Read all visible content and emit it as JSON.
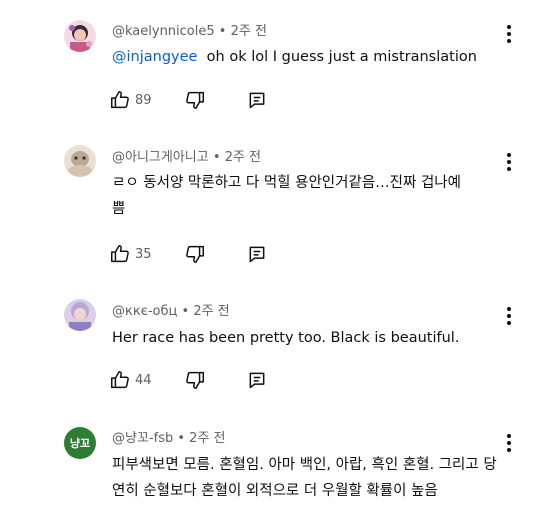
{
  "comments": [
    {
      "handle": "@kaelynnicole5",
      "sep": "•",
      "time": "2주 전",
      "mention": "@injangyee",
      "text": "oh ok lol I guess just a mistranslation",
      "likes": "89"
    },
    {
      "handle": "@아니그게아니고",
      "sep": "•",
      "time": "2주 전",
      "text": "ㄹㅇ 동서양 막론하고 다 먹힐 용안인거같음…진짜 겁나예쁨",
      "likes": "35"
    },
    {
      "handle": "@ккє-обц",
      "sep": "•",
      "time": "2주 전",
      "text": "Her race has been pretty too. Black is beautiful.",
      "likes": "44"
    },
    {
      "handle": "@냥꼬-fsb",
      "sep": "•",
      "time": "2주 전",
      "avatar_text": "냥꼬",
      "text": "피부색보면 모름. 혼혈임. 아마 백인, 아랍, 흑인 혼혈. 그리고 당연히 순혈보다 혼혈이 외적으로 더 우월할 확률이 높음"
    }
  ],
  "colors": {
    "avatar4": "#2e7d32",
    "mention": "#065fd4"
  }
}
